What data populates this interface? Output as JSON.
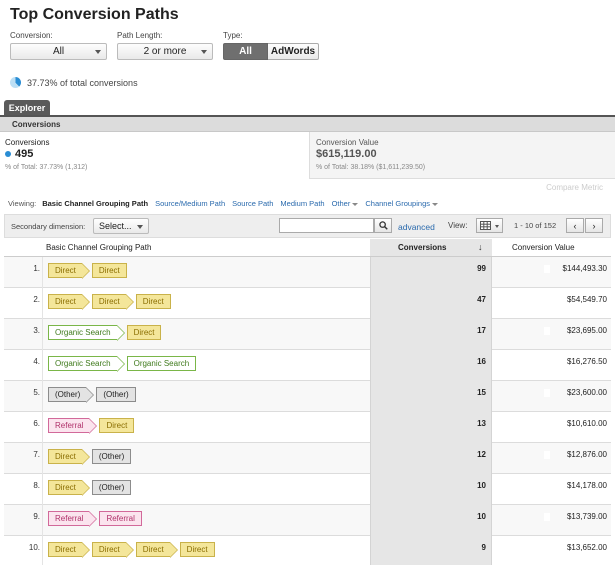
{
  "page": {
    "title": "Top Conversion Paths"
  },
  "filters": {
    "conversion": {
      "label": "Conversion:",
      "value": "All"
    },
    "path_length": {
      "label": "Path Length:",
      "value": "2 or more"
    },
    "type": {
      "label": "Type:",
      "options": [
        "All",
        "AdWords"
      ],
      "selected": "All"
    }
  },
  "summary": {
    "pct_text": "37.73% of total conversions",
    "pct_value": 37.73
  },
  "tabs": {
    "explorer": "Explorer",
    "subtab": "Conversions"
  },
  "metrics": {
    "conversions": {
      "label": "Conversions",
      "value": "495",
      "sub": "% of Total: 37.73% (1,312)",
      "dot_color": "#2a8dd4"
    },
    "conversion_value": {
      "label": "Conversion Value",
      "value": "$615,119.00",
      "sub": "% of Total: 38.18% ($1,611,239.50)"
    },
    "compare": "Compare Metric"
  },
  "viewing": {
    "label": "Viewing:",
    "active": "Basic Channel Grouping Path",
    "links": [
      "Source/Medium Path",
      "Source Path",
      "Medium Path"
    ],
    "other": "Other",
    "channel_groupings": "Channel Groupings"
  },
  "toolbar": {
    "secondary_label": "Secondary dimension:",
    "secondary_value": "Select...",
    "search_placeholder": "",
    "advanced": "advanced",
    "view_label": "View:",
    "pager_text": "1 - 10 of 152",
    "prev": "‹",
    "next": "›"
  },
  "table": {
    "headers": {
      "path": "Basic Channel Grouping Path",
      "conversions": "Conversions",
      "sort_arrow": "↓",
      "value": "Conversion Value"
    },
    "channel_colors": {
      "Direct": {
        "bg": "#f4e69a",
        "border": "#c9b24a",
        "text": "#8a6d00"
      },
      "Organic Search": {
        "bg": "#ffffff",
        "border": "#7ab648",
        "text": "#3f7a1c"
      },
      "(Other)": {
        "bg": "#e3e3e3",
        "border": "#8c8c8c",
        "text": "#222222"
      },
      "Referral": {
        "bg": "#fbe4ee",
        "border": "#d2699a",
        "text": "#b0306a"
      }
    },
    "rows": [
      {
        "num": "1.",
        "path": [
          "Direct",
          "Direct"
        ],
        "conversions": "99",
        "value": "$144,493.30"
      },
      {
        "num": "2.",
        "path": [
          "Direct",
          "Direct",
          "Direct"
        ],
        "conversions": "47",
        "value": "$54,549.70"
      },
      {
        "num": "3.",
        "path": [
          "Organic Search",
          "Direct"
        ],
        "conversions": "17",
        "value": "$23,695.00"
      },
      {
        "num": "4.",
        "path": [
          "Organic Search",
          "Organic Search"
        ],
        "conversions": "16",
        "value": "$16,276.50"
      },
      {
        "num": "5.",
        "path": [
          "(Other)",
          "(Other)"
        ],
        "conversions": "15",
        "value": "$23,600.00"
      },
      {
        "num": "6.",
        "path": [
          "Referral",
          "Direct"
        ],
        "conversions": "13",
        "value": "$10,610.00"
      },
      {
        "num": "7.",
        "path": [
          "Direct",
          "(Other)"
        ],
        "conversions": "12",
        "value": "$12,876.00"
      },
      {
        "num": "8.",
        "path": [
          "Direct",
          "(Other)"
        ],
        "conversions": "10",
        "value": "$14,178.00"
      },
      {
        "num": "9.",
        "path": [
          "Referral",
          "Referral"
        ],
        "conversions": "10",
        "value": "$13,739.00"
      },
      {
        "num": "10.",
        "path": [
          "Direct",
          "Direct",
          "Direct",
          "Direct"
        ],
        "conversions": "9",
        "value": "$13,652.00"
      }
    ]
  }
}
